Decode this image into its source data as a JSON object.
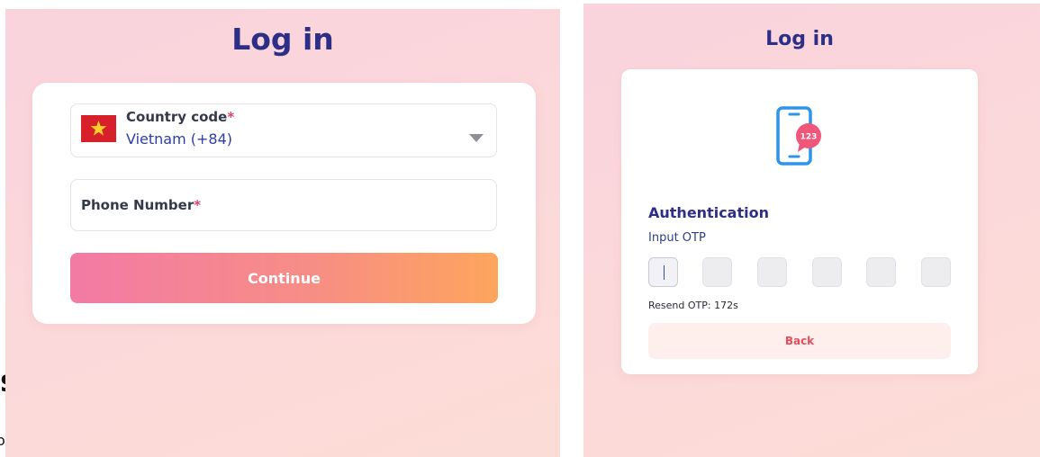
{
  "left_panel": {
    "title": "Log in",
    "country_field": {
      "label": "Country code",
      "required_mark": "*",
      "value": "Vietnam (+84)",
      "flag": "vietnam-flag",
      "dropdown_icon": "caret-down-icon"
    },
    "phone_field": {
      "label": "Phone Number",
      "required_mark": "*"
    },
    "continue_label": "Continue"
  },
  "right_panel": {
    "title": "Log in",
    "icon": "phone-otp-icon",
    "icon_badge": "123",
    "heading": "Authentication",
    "otp_label": "Input OTP",
    "otp_boxes": [
      "",
      "",
      "",
      "",
      "",
      ""
    ],
    "resend_text": "Resend OTP: 172s",
    "back_label": "Back"
  },
  "page_fragments": [
    "s",
    "o"
  ],
  "colors": {
    "title": "#2d2f86",
    "accent_pink": "#f27aa5",
    "accent_orange": "#fda55c",
    "required": "#e2456a",
    "back_text": "#e0505f"
  }
}
